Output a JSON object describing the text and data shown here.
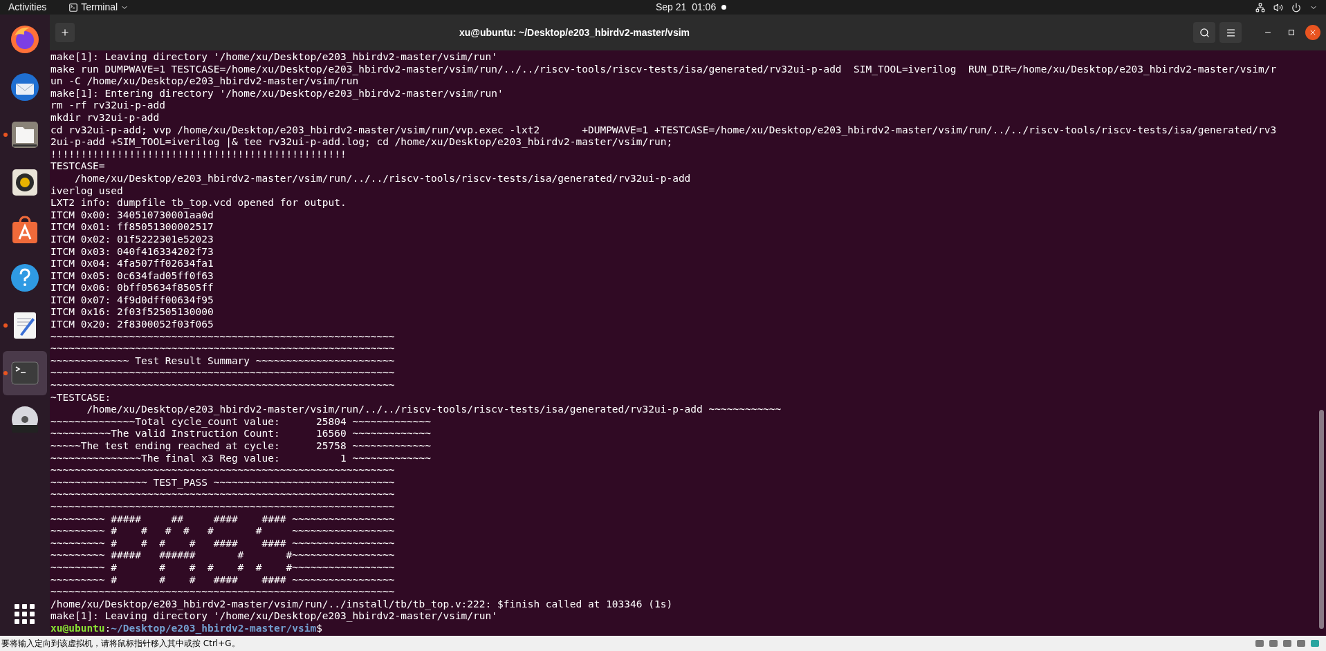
{
  "top_bar": {
    "activities": "Activities",
    "app_menu": "Terminal",
    "date": "Sep 21",
    "time": "01:06",
    "notification_dot": true
  },
  "dock": [
    {
      "kind": "firefox",
      "running": false,
      "selected": false
    },
    {
      "kind": "mail",
      "running": false,
      "selected": false
    },
    {
      "kind": "files",
      "running": true,
      "selected": false
    },
    {
      "kind": "speaker",
      "running": false,
      "selected": false
    },
    {
      "kind": "store",
      "running": false,
      "selected": false
    },
    {
      "kind": "help",
      "running": false,
      "selected": false
    },
    {
      "kind": "editor",
      "running": true,
      "selected": false
    },
    {
      "kind": "terminal",
      "running": true,
      "selected": true
    },
    {
      "kind": "disc",
      "running": false,
      "selected": false
    }
  ],
  "window": {
    "title": "xu@ubuntu: ~/Desktop/e203_hbirdv2-master/vsim"
  },
  "terminal": {
    "lines": [
      "make[1]: Leaving directory '/home/xu/Desktop/e203_hbirdv2-master/vsim/run'",
      "make run DUMPWAVE=1 TESTCASE=/home/xu/Desktop/e203_hbirdv2-master/vsim/run/../../riscv-tools/riscv-tests/isa/generated/rv32ui-p-add  SIM_TOOL=iverilog  RUN_DIR=/home/xu/Desktop/e203_hbirdv2-master/vsim/r",
      "un -C /home/xu/Desktop/e203_hbirdv2-master/vsim/run",
      "make[1]: Entering directory '/home/xu/Desktop/e203_hbirdv2-master/vsim/run'",
      "rm -rf rv32ui-p-add",
      "mkdir rv32ui-p-add",
      "cd rv32ui-p-add; vvp /home/xu/Desktop/e203_hbirdv2-master/vsim/run/vvp.exec -lxt2       +DUMPWAVE=1 +TESTCASE=/home/xu/Desktop/e203_hbirdv2-master/vsim/run/../../riscv-tools/riscv-tests/isa/generated/rv3",
      "2ui-p-add +SIM_TOOL=iverilog |& tee rv32ui-p-add.log; cd /home/xu/Desktop/e203_hbirdv2-master/vsim/run;",
      "!!!!!!!!!!!!!!!!!!!!!!!!!!!!!!!!!!!!!!!!!!!!!!!!!",
      "TESTCASE=",
      "    /home/xu/Desktop/e203_hbirdv2-master/vsim/run/../../riscv-tools/riscv-tests/isa/generated/rv32ui-p-add",
      "iverlog used",
      "LXT2 info: dumpfile tb_top.vcd opened for output.",
      "ITCM 0x00: 340510730001aa0d",
      "ITCM 0x01: ff85051300002517",
      "ITCM 0x02: 01f5222301e52023",
      "ITCM 0x03: 040f416334202f73",
      "ITCM 0x04: 4fa507ff02634fa1",
      "ITCM 0x05: 0c634fad05ff0f63",
      "ITCM 0x06: 0bff05634f8505ff",
      "ITCM 0x07: 4f9d0dff00634f95",
      "ITCM 0x16: 2f03f52505130000",
      "ITCM 0x20: 2f8300052f03f065",
      "~~~~~~~~~~~~~~~~~~~~~~~~~~~~~~~~~~~~~~~~~~~~~~~~~~~~~~~~~",
      "~~~~~~~~~~~~~~~~~~~~~~~~~~~~~~~~~~~~~~~~~~~~~~~~~~~~~~~~~",
      "~~~~~~~~~~~~~ Test Result Summary ~~~~~~~~~~~~~~~~~~~~~~~",
      "~~~~~~~~~~~~~~~~~~~~~~~~~~~~~~~~~~~~~~~~~~~~~~~~~~~~~~~~~",
      "~~~~~~~~~~~~~~~~~~~~~~~~~~~~~~~~~~~~~~~~~~~~~~~~~~~~~~~~~",
      "~TESTCASE:",
      "      /home/xu/Desktop/e203_hbirdv2-master/vsim/run/../../riscv-tools/riscv-tests/isa/generated/rv32ui-p-add ~~~~~~~~~~~~",
      "~~~~~~~~~~~~~~Total cycle_count value:      25804 ~~~~~~~~~~~~~",
      "~~~~~~~~~~The valid Instruction Count:      16560 ~~~~~~~~~~~~~",
      "~~~~~The test ending reached at cycle:      25758 ~~~~~~~~~~~~~",
      "~~~~~~~~~~~~~~~The final x3 Reg value:          1 ~~~~~~~~~~~~~",
      "~~~~~~~~~~~~~~~~~~~~~~~~~~~~~~~~~~~~~~~~~~~~~~~~~~~~~~~~~",
      "~~~~~~~~~~~~~~~~ TEST_PASS ~~~~~~~~~~~~~~~~~~~~~~~~~~~~~~",
      "~~~~~~~~~~~~~~~~~~~~~~~~~~~~~~~~~~~~~~~~~~~~~~~~~~~~~~~~~",
      "~~~~~~~~~~~~~~~~~~~~~~~~~~~~~~~~~~~~~~~~~~~~~~~~~~~~~~~~~",
      "~~~~~~~~~ #####     ##     ####    #### ~~~~~~~~~~~~~~~~~",
      "~~~~~~~~~ #    #   #  #   #       #     ~~~~~~~~~~~~~~~~~",
      "~~~~~~~~~ #    #  #    #   ####    #### ~~~~~~~~~~~~~~~~~",
      "~~~~~~~~~ #####   ######       #       #~~~~~~~~~~~~~~~~~",
      "~~~~~~~~~ #       #    #  #    #  #    #~~~~~~~~~~~~~~~~~",
      "~~~~~~~~~ #       #    #   ####    #### ~~~~~~~~~~~~~~~~~",
      "~~~~~~~~~~~~~~~~~~~~~~~~~~~~~~~~~~~~~~~~~~~~~~~~~~~~~~~~~",
      "/home/xu/Desktop/e203_hbirdv2-master/vsim/run/../install/tb/tb_top.v:222: $finish called at 103346 (1s)",
      "make[1]: Leaving directory '/home/xu/Desktop/e203_hbirdv2-master/vsim/run'"
    ],
    "prompt": {
      "user": "xu@ubuntu",
      "separator": ":",
      "path": "~/Desktop/e203_hbirdv2-master/vsim",
      "symbol": "$"
    }
  },
  "status_bar": {
    "message": "要将输入定向到该虚拟机，请将鼠标指针移入其中或按 Ctrl+G。"
  }
}
